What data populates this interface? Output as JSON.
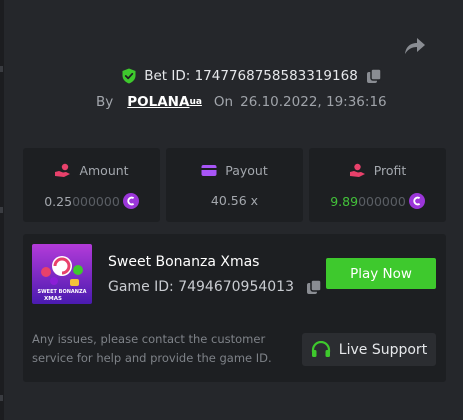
{
  "bet": {
    "label": "Bet ID: 1747768758583319168",
    "by_label": "By",
    "user_name": "POLANA",
    "user_suffix": "ua",
    "on_label": "On",
    "timestamp": "26.10.2022, 19:36:16"
  },
  "stats": {
    "amount": {
      "label": "Amount",
      "value_main": "0.25",
      "value_dim": "000000"
    },
    "payout": {
      "label": "Payout",
      "value": "40.56 x"
    },
    "profit": {
      "label": "Profit",
      "value_main": "9.89",
      "value_dim": "000000"
    }
  },
  "game": {
    "title": "Sweet Bonanza Xmas",
    "id_label": "Game ID: 7494670954013",
    "thumb_text_1": "SWEET BONANZA",
    "thumb_text_2": "XMAS",
    "play_label": "Play Now"
  },
  "support": {
    "message": "Any issues, please contact the customer service for help and provide the game ID.",
    "button_label": "Live Support"
  },
  "colors": {
    "background": "#25272b",
    "panel": "#1d1f22",
    "accent_green": "#3ec92d",
    "profit_green": "#43c23a",
    "icon_pink": "#e8416b",
    "icon_purple": "#a855f7",
    "coin_purple": "#9b36d9"
  },
  "icons": [
    "share-icon",
    "shield-check-icon",
    "copy-icon",
    "hand-coins-icon",
    "wallet-icon",
    "profit-hand-icon",
    "coin-icon",
    "headset-icon"
  ]
}
